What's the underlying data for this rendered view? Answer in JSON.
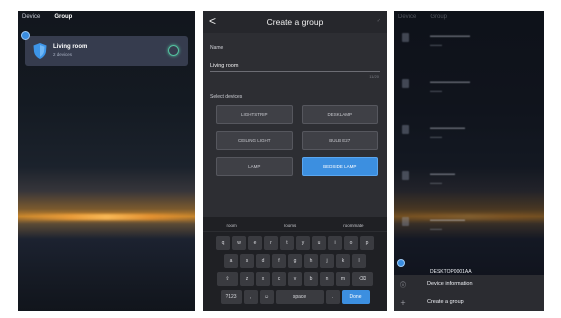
{
  "phone1": {
    "tabs": [
      "Device",
      "Group"
    ],
    "active_tab": "Group",
    "room_card": {
      "title": "Living room",
      "subtitle": "2 devices"
    }
  },
  "phone2": {
    "title": "Create a group",
    "name_label": "Name",
    "name_value": "Living room",
    "counter": "11/20",
    "select_label": "Select devices",
    "devices": [
      {
        "label": "LIGHTSTRIP",
        "selected": false
      },
      {
        "label": "DESKLAMP",
        "selected": false
      },
      {
        "label": "CEILING LIGHT",
        "selected": false
      },
      {
        "label": "BULB E27",
        "selected": false
      },
      {
        "label": "LAMP",
        "selected": false
      },
      {
        "label": "BEDSIDE LAMP",
        "selected": true
      }
    ],
    "keyboard": {
      "suggestions": [
        "room",
        "rooms",
        "roommate"
      ],
      "row1": [
        "q",
        "w",
        "e",
        "r",
        "t",
        "y",
        "u",
        "i",
        "o",
        "p"
      ],
      "row2": [
        "a",
        "s",
        "d",
        "f",
        "g",
        "h",
        "j",
        "k",
        "l"
      ],
      "row3": [
        "⇧",
        "z",
        "x",
        "c",
        "v",
        "b",
        "n",
        "m",
        "⌫"
      ],
      "row4": [
        "?123",
        ",",
        "☺",
        "space",
        ".",
        "Done"
      ]
    }
  },
  "phone3": {
    "tabs": [
      "Device",
      "Group"
    ],
    "highlighted_item": "DESKTOP0001AA",
    "menu": [
      {
        "icon": "info-icon",
        "label": "Device information"
      },
      {
        "icon": "plus-icon",
        "label": "Create a group"
      }
    ]
  },
  "colors": {
    "accent": "#3c8fe0",
    "power_on": "#54c3a0",
    "card": "#3a4052"
  }
}
